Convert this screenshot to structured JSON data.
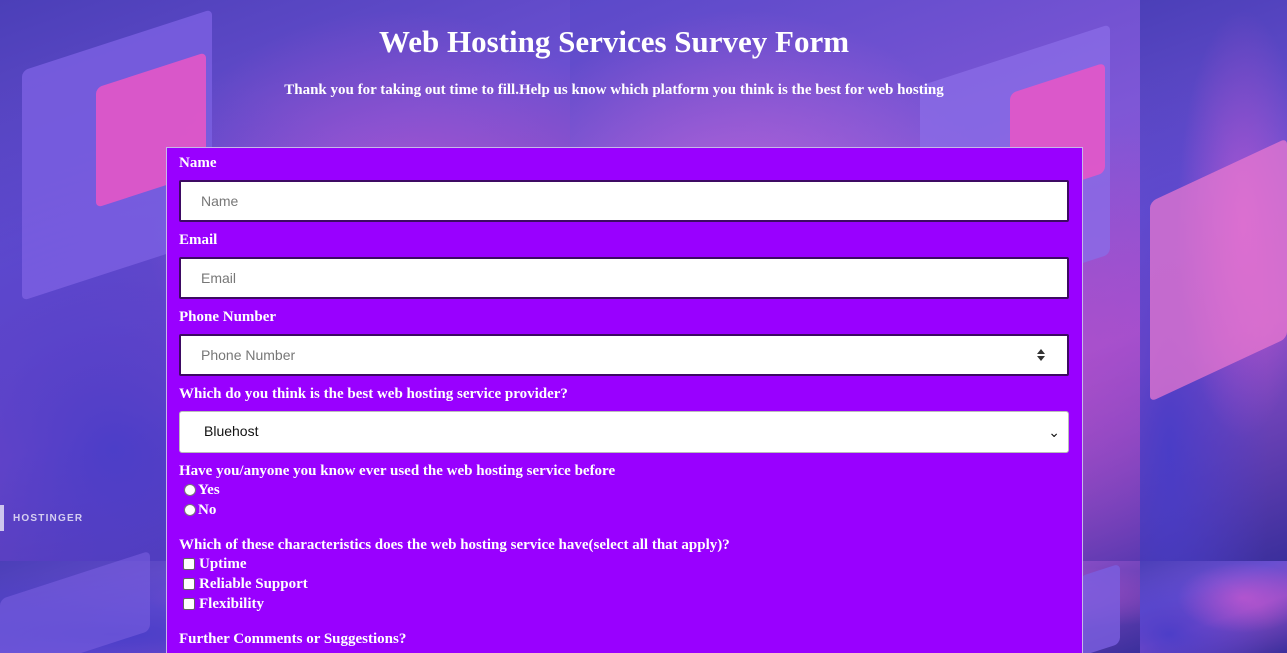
{
  "page": {
    "title": "Web Hosting Services Survey Form",
    "subtitle": "Thank you for taking out time to fill.Help us know which platform you think is the best for web hosting"
  },
  "background": {
    "brand": "HOSTINGER"
  },
  "form": {
    "name": {
      "label": "Name",
      "placeholder": "Name"
    },
    "email": {
      "label": "Email",
      "placeholder": "Email"
    },
    "phone": {
      "label": "Phone Number",
      "placeholder": "Phone Number"
    },
    "provider": {
      "label": "Which do you think is the best web hosting service provider?",
      "selected": "Bluehost"
    },
    "used_before": {
      "label": "Have you/anyone you know ever used the web hosting service before",
      "options": [
        "Yes",
        "No"
      ]
    },
    "characteristics": {
      "label": "Which of these characteristics does the web hosting service have(select all that apply)?",
      "options": [
        "Uptime",
        "Reliable Support",
        "Flexibility"
      ]
    },
    "comments": {
      "label": "Further Comments or Suggestions?"
    }
  },
  "colors": {
    "form_bg": "#9900ff",
    "text": "#ffffff",
    "field_border": "#3d0a63"
  }
}
